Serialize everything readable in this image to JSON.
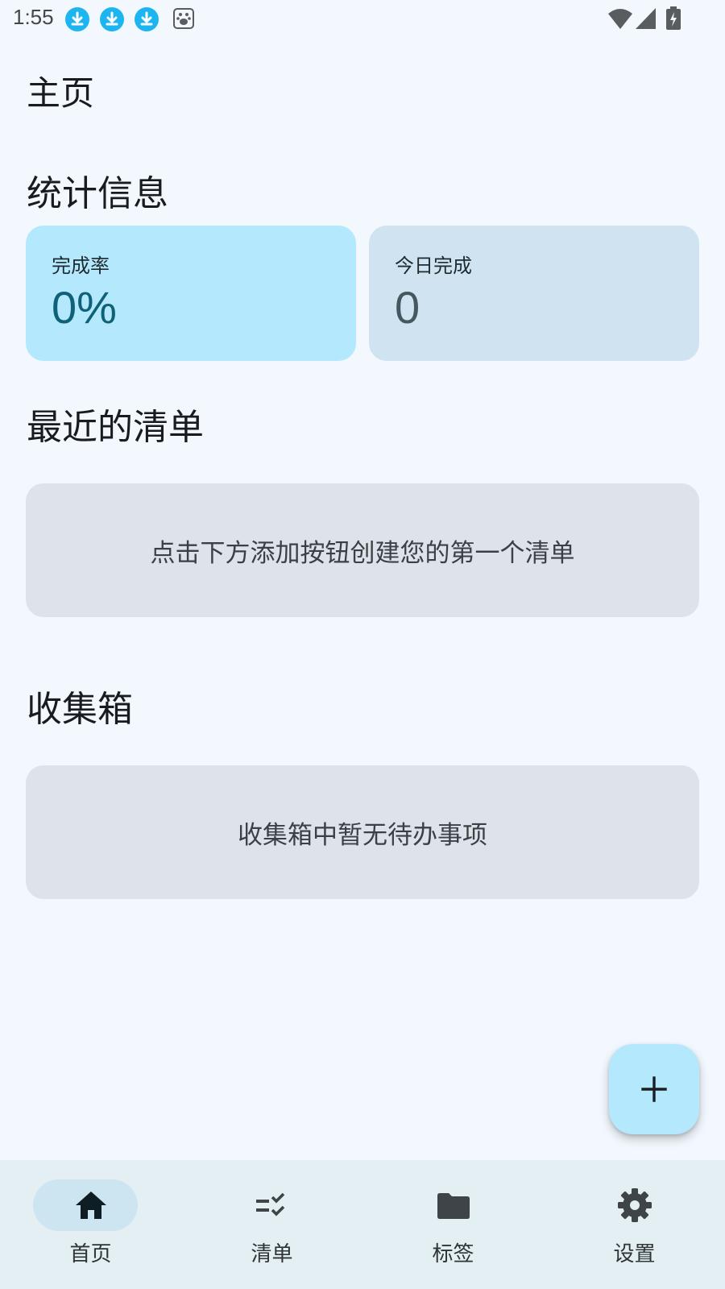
{
  "status_bar": {
    "time": "1:55"
  },
  "page_title": "主页",
  "stats": {
    "title": "统计信息",
    "completion_rate": {
      "label": "完成率",
      "value": "0%"
    },
    "completed_today": {
      "label": "今日完成",
      "value": "0"
    }
  },
  "recent_lists": {
    "title": "最近的清单",
    "empty_text": "点击下方添加按钮创建您的第一个清单"
  },
  "inbox": {
    "title": "收集箱",
    "empty_text": "收集箱中暂无待办事项"
  },
  "fab": {
    "icon": "plus-icon"
  },
  "bottom_nav": {
    "selected": "home",
    "items": [
      {
        "id": "home",
        "label": "首页",
        "icon": "home-icon"
      },
      {
        "id": "lists",
        "label": "清单",
        "icon": "checklist-icon"
      },
      {
        "id": "tags",
        "label": "标签",
        "icon": "folder-icon"
      },
      {
        "id": "settings",
        "label": "设置",
        "icon": "gear-icon"
      }
    ]
  },
  "colors": {
    "background": "#f2f8fe",
    "primary_container": "#b3e8fd",
    "secondary_container": "#cfe4f0",
    "surface_variant": "#dde3e9",
    "nav_background": "#e4eff3",
    "notification_accent": "#1cb5f0"
  }
}
